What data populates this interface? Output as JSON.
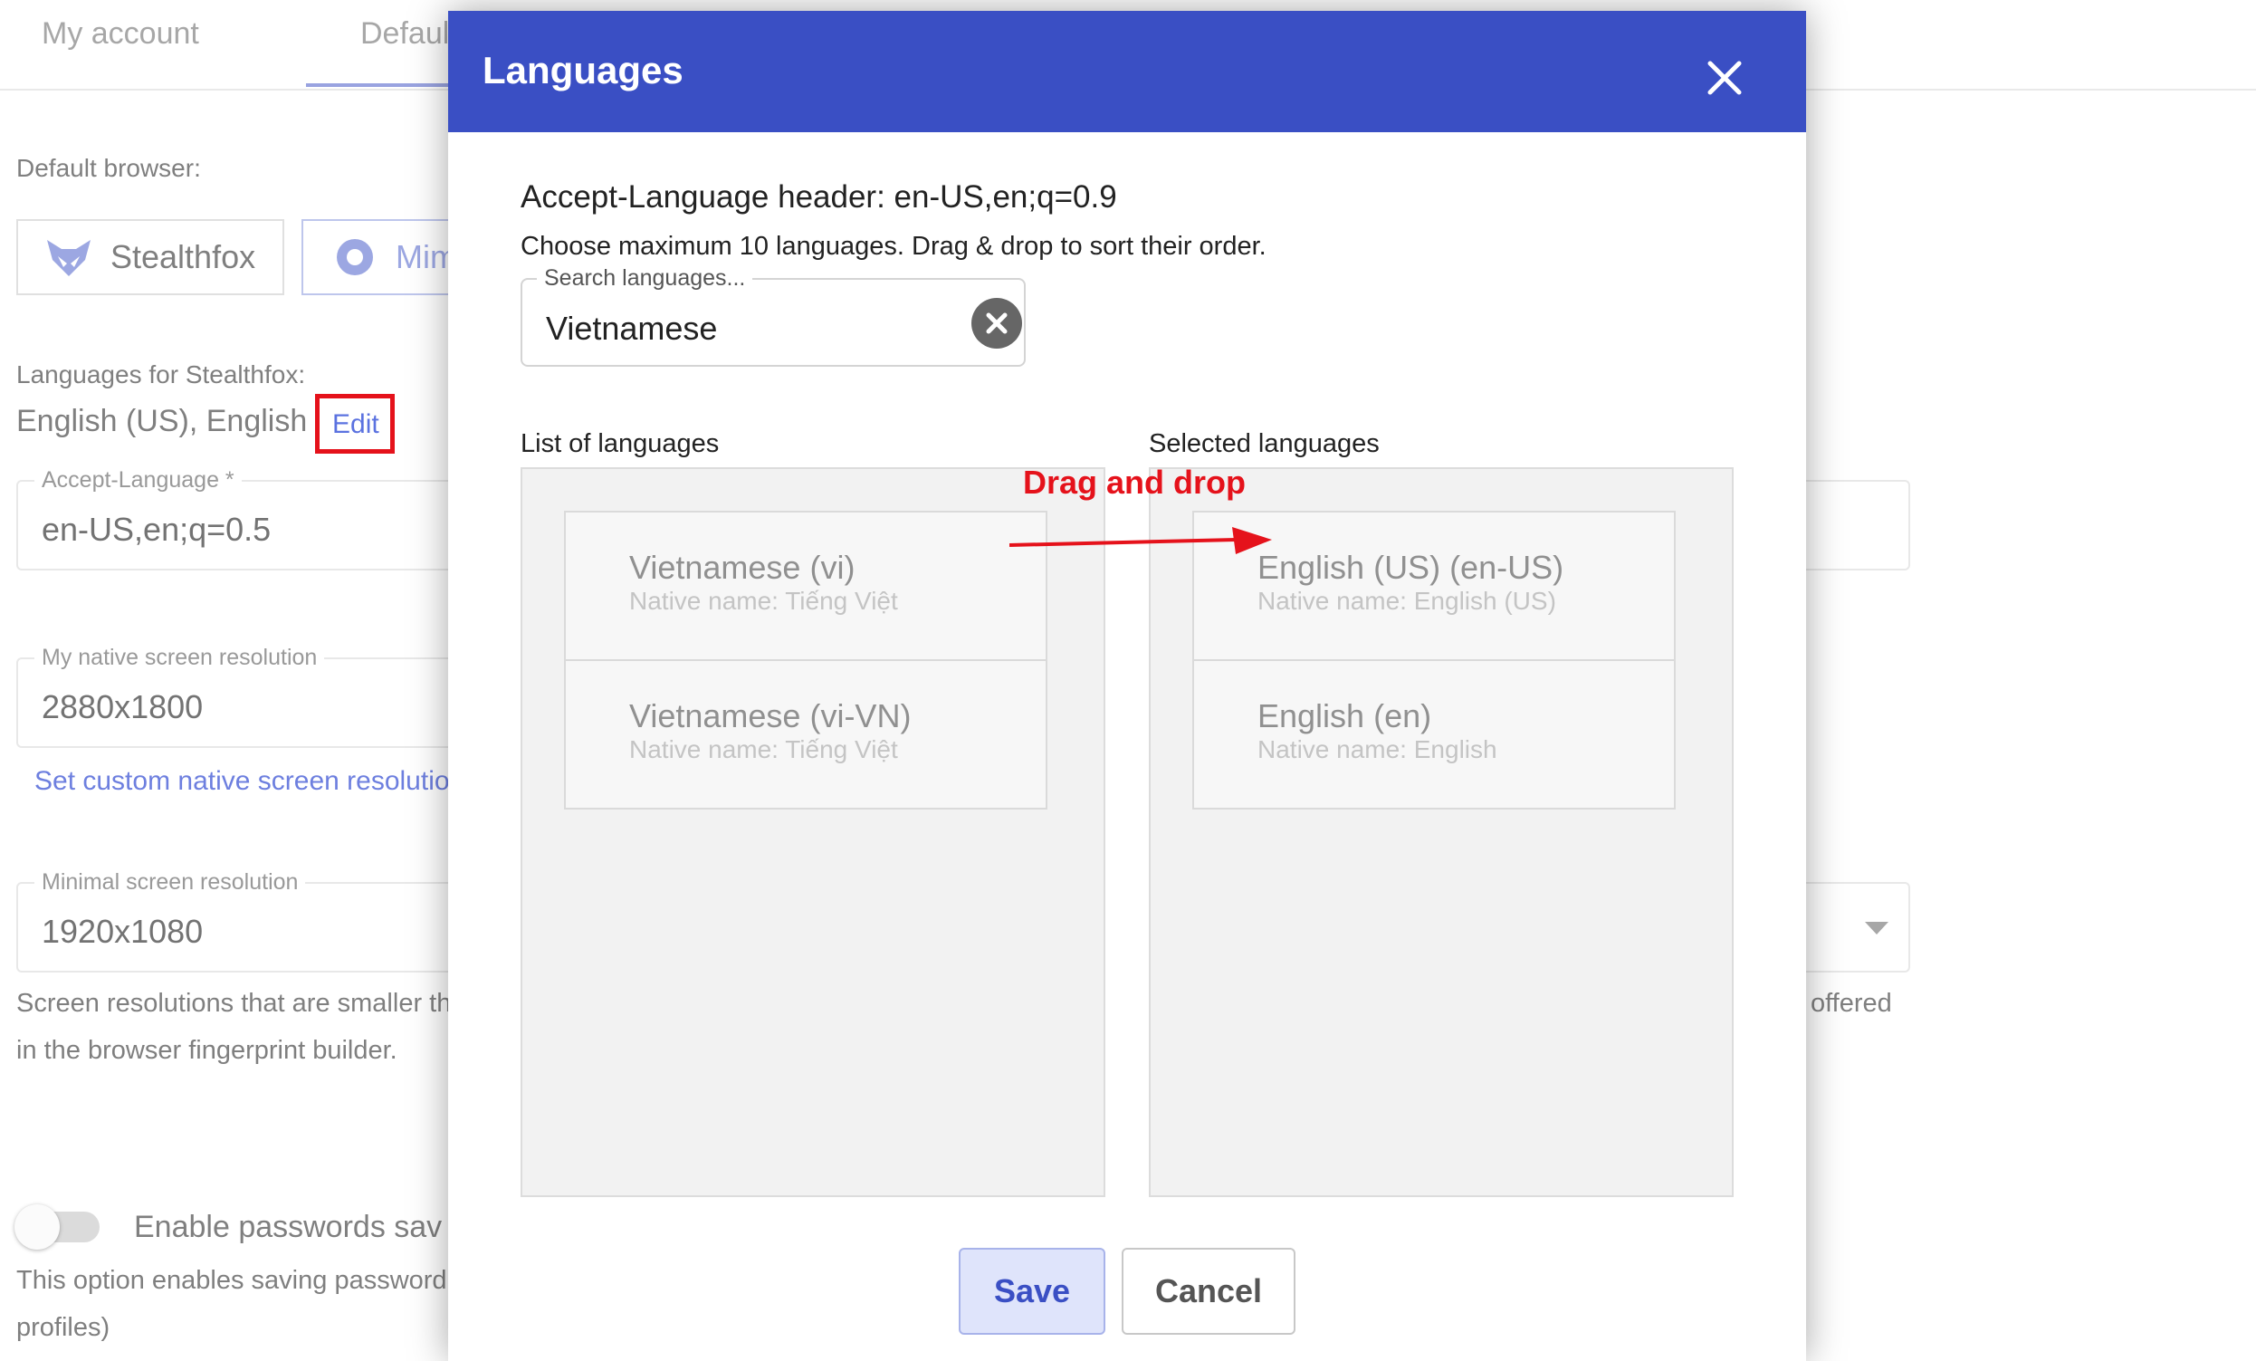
{
  "background": {
    "tabs": [
      "My account",
      "Defaul"
    ],
    "default_browser_label": "Default browser:",
    "browsers": [
      "Stealthfox",
      "Mim"
    ],
    "languages_label": "Languages for Stealthfox:",
    "languages_value": "English (US), English",
    "edit_label": "Edit",
    "accept_language": {
      "label": "Accept-Language *",
      "value": "en-US,en;q=0.5"
    },
    "native_resolution": {
      "label": "My native screen resolution",
      "value": "2880x1800"
    },
    "custom_resolution_link": "Set custom native screen resolutio",
    "minimal_resolution": {
      "label": "Minimal screen resolution",
      "value": "1920x1080"
    },
    "resolution_note_line1": "Screen resolutions that are smaller th",
    "resolution_note_right": "offered",
    "resolution_note_line2": "in the browser fingerprint builder.",
    "passwords_toggle_label": "Enable passwords sav",
    "passwords_note_line1": "This option enables saving password",
    "passwords_note_line2": "profiles)"
  },
  "modal": {
    "title": "Languages",
    "accept_header": "Accept-Language header: en-US,en;q=0.9",
    "instruction": "Choose maximum 10 languages. Drag & drop to sort their order.",
    "search": {
      "label": "Search languages...",
      "value": "Vietnamese"
    },
    "list_label": "List of languages",
    "selected_label": "Selected languages",
    "available": [
      {
        "name": "Vietnamese (vi)",
        "native": "Native name: Tiếng Việt"
      },
      {
        "name": "Vietnamese (vi-VN)",
        "native": "Native name: Tiếng Việt"
      }
    ],
    "selected": [
      {
        "name": "English (US) (en-US)",
        "native": "Native name: English (US)"
      },
      {
        "name": "English (en)",
        "native": "Native name: English"
      }
    ],
    "annotation": "Drag and drop",
    "save_label": "Save",
    "cancel_label": "Cancel"
  },
  "colors": {
    "header": "#3a4fc4",
    "annotation": "#e5121b",
    "link": "#3d55d4"
  }
}
